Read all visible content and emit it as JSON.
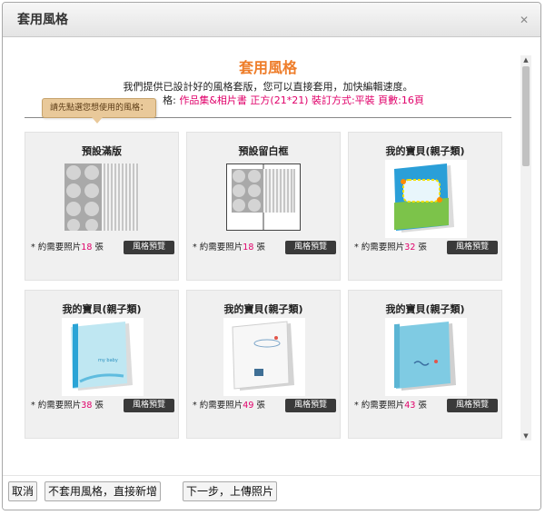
{
  "window": {
    "title": "套用風格"
  },
  "header": {
    "title": "套用風格",
    "description": "我們提供已設計好的風格套版，您可以直接套用，加快編輯速度。",
    "meta_label": "格:",
    "meta_value": "作品集&相片書 正方(21*21) 裝訂方式:平裝 頁數:16頁"
  },
  "tooltip": "請先點選您想使用的風格：",
  "cards": [
    {
      "title": "預設滿版",
      "photos_prefix": "* 約需要照片",
      "count": "18",
      "unit": "張",
      "button": "風格預覽"
    },
    {
      "title": "預設留白框",
      "photos_prefix": "* 約需要照片",
      "count": "18",
      "unit": "張",
      "button": "風格預覽"
    },
    {
      "title": "我的寶貝(親子類)",
      "photos_prefix": "* 約需要照片",
      "count": "32",
      "unit": "張",
      "button": "風格預覽"
    },
    {
      "title": "我的寶貝(親子類)",
      "photos_prefix": "* 約需要照片",
      "count": "38",
      "unit": "張",
      "button": "風格預覽"
    },
    {
      "title": "我的寶貝(親子類)",
      "photos_prefix": "* 約需要照片",
      "count": "49",
      "unit": "張",
      "button": "風格預覽"
    },
    {
      "title": "我的寶貝(親子類)",
      "photos_prefix": "* 約需要照片",
      "count": "43",
      "unit": "張",
      "button": "風格預覽"
    }
  ],
  "footer": {
    "cancel": "取消",
    "skip": "不套用風格，直接新增",
    "next": "下一步，上傳照片"
  },
  "colors": {
    "accent": "#ee7d2a",
    "count": "#e0006a",
    "preview_button": "#3a3a3a",
    "tooltip": "#e9c99a"
  },
  "icons": [
    "close-icon",
    "scroll-up-icon",
    "scroll-down-icon"
  ]
}
